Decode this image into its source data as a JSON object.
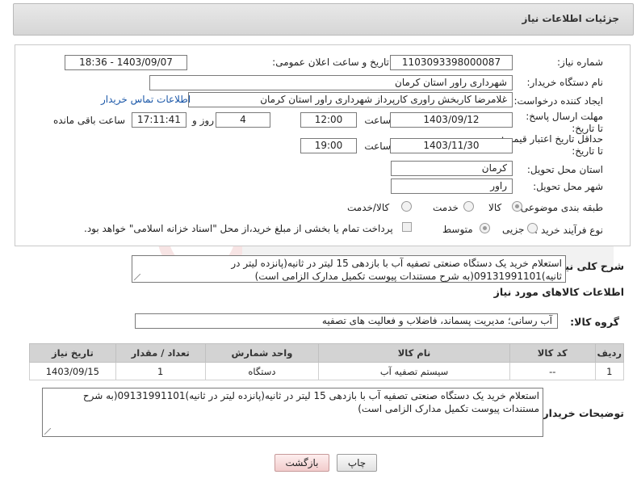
{
  "header": {
    "title": "جزئیات اطلاعات نیاز"
  },
  "form": {
    "need_number_label": "شماره نیاز:",
    "need_number": "1103093398000087",
    "announce_label": "تاریخ و ساعت اعلان عمومی:",
    "announce_value": "1403/09/07 - 18:36",
    "buyer_org_label": "نام دستگاه خریدار:",
    "buyer_org": "شهرداری راور استان کرمان",
    "creator_label": "ایجاد کننده درخواست:",
    "creator": "غلامرضا کاربخش راوری کارپرداز  شهرداری راور استان کرمان",
    "contact_link": "اطلاعات تماس خریدار",
    "deadline_label": "مهلت ارسال پاسخ: تا تاریخ:",
    "deadline_date": "1403/09/12",
    "time_label": "ساعت",
    "deadline_time": "12:00",
    "days_value": "4",
    "days_label": "روز و",
    "remaining_time": "17:11:41",
    "remaining_label": "ساعت باقی مانده",
    "validity_label": "حداقل تاریخ اعتبار قیمت: تا تاریخ:",
    "validity_date": "1403/11/30",
    "validity_time_label": "ساعت",
    "validity_time": "19:00",
    "province_label": "استان محل تحویل:",
    "province": "کرمان",
    "city_label": "شهر محل تحویل:",
    "city": "راور",
    "category_label": "طبقه بندی موضوعی:",
    "category_options": [
      "کالا",
      "خدمت",
      "کالا/خدمت"
    ],
    "process_label": "نوع فرآیند خرید :",
    "process_options": [
      "جزیی",
      "متوسط"
    ],
    "payment_note": "پرداخت تمام یا بخشی از مبلغ خرید،از محل \"اسناد خزانه اسلامی\" خواهد بود."
  },
  "general_desc": {
    "label": "شرح کلی نیاز:",
    "text": "استعلام خرید یک دستگاه صنعتی تصفیه آب با بازدهی 15 لیتر در ثانیه(پانزده لیتر در ثانیه)09131991101(به شرح مستندات پیوست تکمیل مدارک الزامی است)"
  },
  "goods_section": {
    "title": "اطلاعات کالاهای مورد نیاز",
    "group_label": "گروه کالا:",
    "group_value": "آب رسانی؛ مدیریت پسماند، فاضلاب و فعالیت های تصفیه"
  },
  "table": {
    "headers": [
      "ردیف",
      "کد کالا",
      "نام کالا",
      "واحد شمارش",
      "تعداد / مقدار",
      "تاریخ نیاز"
    ],
    "rows": [
      [
        "1",
        "--",
        "سیستم تصفیه آب",
        "دستگاه",
        "1",
        "1403/09/15"
      ]
    ]
  },
  "buyer_desc": {
    "label": "توضیحات خریدار:",
    "text": "استعلام خرید یک دستگاه صنعتی تصفیه آب با بازدهی 15 لیتر در ثانیه(پانزده لیتر در ثانیه)09131991101(به شرح مستندات پیوست تکمیل مدارک الزامی است)"
  },
  "buttons": {
    "print": "چاپ",
    "back": "بازگشت"
  },
  "colors": {
    "link": "#1a57a8",
    "header_bg": "#dcdcdc",
    "table_header": "#d3d3d3"
  }
}
